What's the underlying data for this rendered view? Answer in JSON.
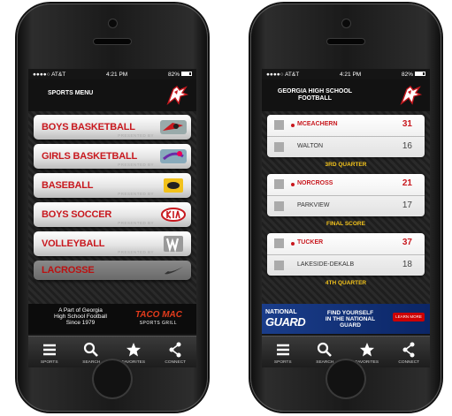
{
  "colors": {
    "accent_red": "#c8181e",
    "gold": "#f2c21b"
  },
  "left": {
    "status": {
      "carrier": "●●●●○ AT&T",
      "time": "4:21 PM",
      "battery": "82%"
    },
    "header_title": "SPORTS MENU",
    "sponsor_text": "PRESENTED BY",
    "menu": [
      {
        "label": "BOYS BASKETBALL",
        "sponsor_icon": "hawks-logo-icon"
      },
      {
        "label": "GIRLS BASKETBALL",
        "sponsor_icon": "dream-logo-icon"
      },
      {
        "label": "BASEBALL",
        "sponsor_icon": "baseball-sponsor-icon"
      },
      {
        "label": "BOYS SOCCER",
        "sponsor_icon": "kia-logo-icon"
      },
      {
        "label": "VOLLEYBALL",
        "sponsor_icon": "wilson-logo-icon"
      },
      {
        "label": "LACROSSE",
        "sponsor_icon": "nike-logo-icon"
      }
    ],
    "ad": {
      "line1": "A Part of Georgia",
      "line2": "High School Football",
      "line3": "Since 1979",
      "brand": "TACO MAC",
      "tagline": "SPORTS GRILL"
    }
  },
  "right": {
    "status": {
      "carrier": "●●●●○ AT&T",
      "time": "4:21 PM",
      "battery": "82%"
    },
    "header_line1": "GEORGIA HIGH SCHOOL",
    "header_line2": "FOOTBALL",
    "games": [
      {
        "team1": "MCEACHERN",
        "score1": "31",
        "team2": "WALTON",
        "score2": "16",
        "status": "3RD QUARTER"
      },
      {
        "team1": "NORCROSS",
        "score1": "21",
        "team2": "PARKVIEW",
        "score2": "17",
        "status": "FINAL SCORE"
      },
      {
        "team1": "TUCKER",
        "score1": "37",
        "team2": "LAKESIDE-DEKALB",
        "score2": "18",
        "status": "4TH QUARTER"
      }
    ],
    "ad": {
      "brand1": "NATIONAL",
      "brand2": "GUARD",
      "line1": "FIND YOURSELF",
      "line2": "IN THE NATIONAL GUARD",
      "cta": "LEARN MORE"
    }
  },
  "tabs": [
    {
      "label": "SPORTS",
      "icon": "menu-icon"
    },
    {
      "label": "SEARCH",
      "icon": "search-icon"
    },
    {
      "label": "FAVORITES",
      "icon": "star-icon"
    },
    {
      "label": "CONNECT",
      "icon": "share-icon"
    }
  ]
}
